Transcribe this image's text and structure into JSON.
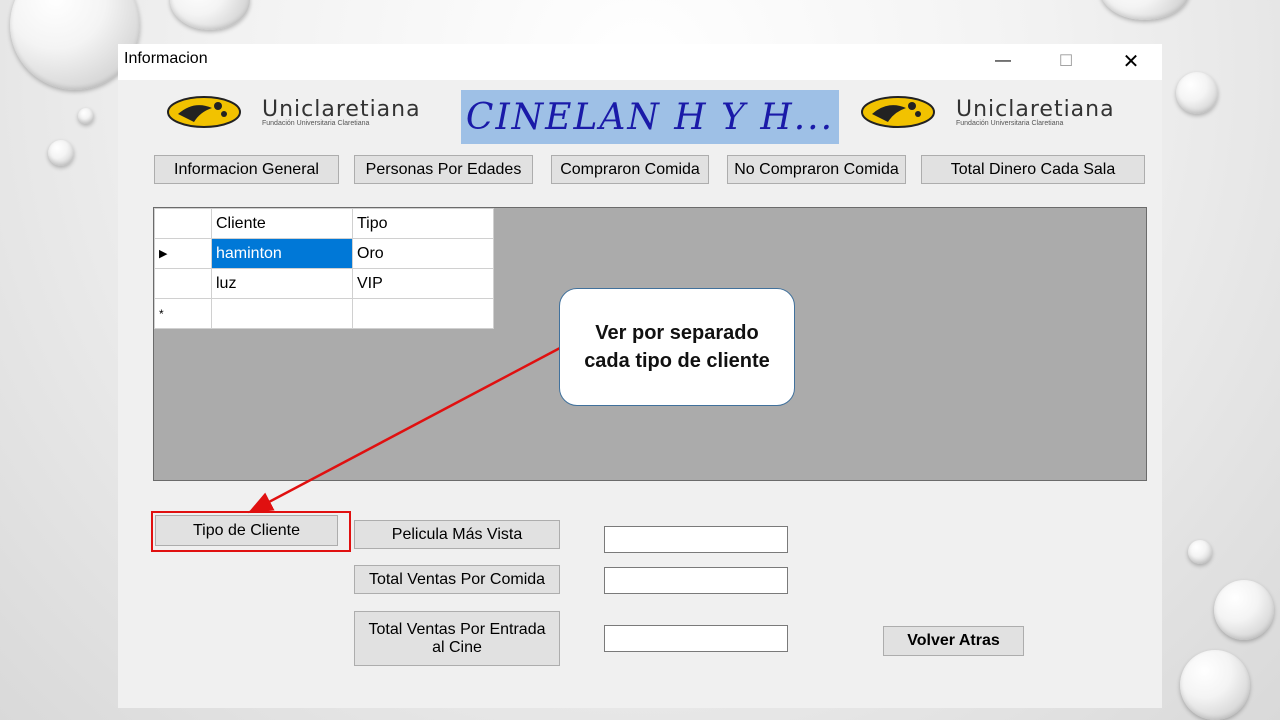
{
  "window": {
    "title": "Informacion",
    "controls": {
      "minimize": "—",
      "maximize": "☐",
      "close": "✕"
    }
  },
  "header": {
    "logo_name": "Uniclaretiana",
    "logo_subtitle": "Fundación Universitaria Claretiana",
    "banner_text": "CINELAN H Y H..."
  },
  "nav_buttons": [
    "Informacion General",
    "Personas Por Edades",
    "Compraron Comida",
    "No Compraron Comida",
    "Total Dinero Cada Sala"
  ],
  "grid": {
    "columns": [
      "Cliente",
      "Tipo"
    ],
    "rows": [
      {
        "indicator": "▶",
        "cliente": "haminton",
        "tipo": "Oro"
      },
      {
        "indicator": "",
        "cliente": "luz",
        "tipo": "VIP"
      }
    ],
    "new_row_indicator": "*"
  },
  "action_buttons": {
    "tipo_cliente": "Tipo de Cliente",
    "pelicula": "Pelicula Más Vista",
    "ventas_comida": "Total Ventas Por Comida",
    "ventas_entrada": "Total Ventas Por Entrada al Cine",
    "volver": "Volver Atras"
  },
  "fields": {
    "pelicula": "",
    "ventas_comida": "",
    "ventas_entrada": ""
  },
  "callout": {
    "text": "Ver por separado cada tipo de cliente"
  },
  "colors": {
    "highlight": "#e01010",
    "selection": "#0078d7",
    "banner": "#9ec0e6"
  }
}
